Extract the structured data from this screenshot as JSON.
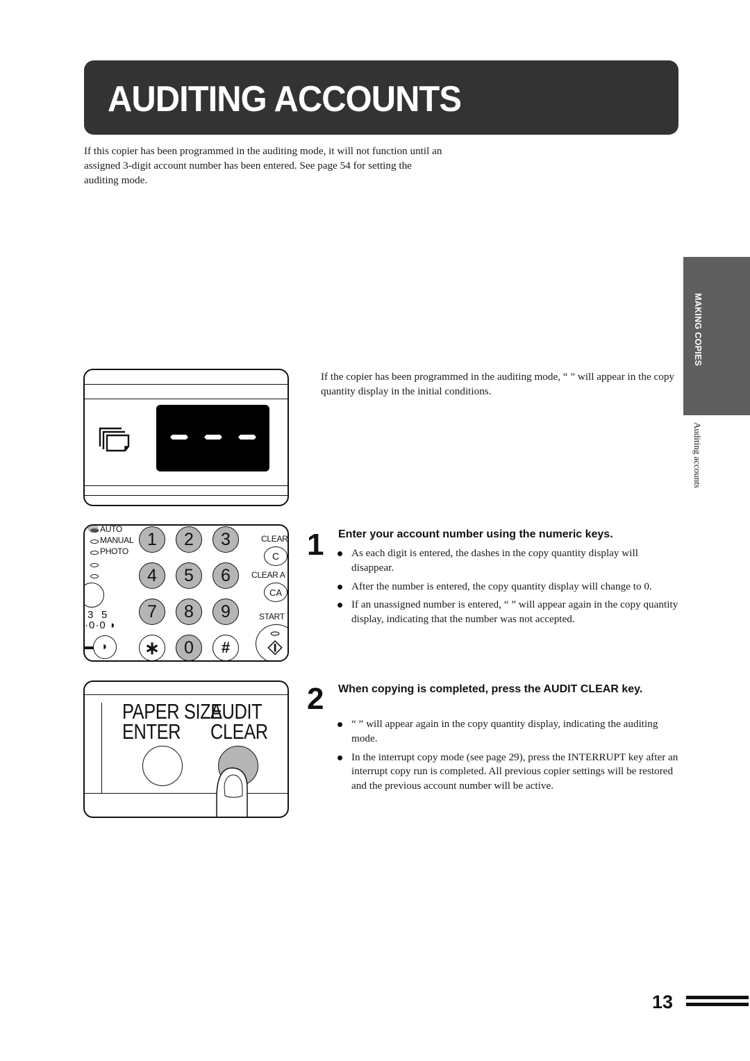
{
  "header": {
    "title": "AUDITING ACCOUNTS"
  },
  "intro": "If this copier  has been programmed in the auditing mode, it will not function until an assigned 3-digit account number has been entered. See page 54 for setting the auditing mode.",
  "side_tab": {
    "section": "MAKING COPIES",
    "subsection": "Auditing accounts"
  },
  "display_panel": {
    "icon": "copies-stack-icon",
    "readout": "- - -"
  },
  "display_description": "If the copier has been programmed in the auditing mode, “        ” will appear in the copy quantity display in the initial conditions.",
  "keypad_panel": {
    "exposure_modes": [
      "AUTO",
      "MANUAL",
      "PHOTO"
    ],
    "density_labels": [
      "3",
      "5"
    ],
    "keys": [
      "1",
      "2",
      "3",
      "4",
      "5",
      "6",
      "7",
      "8",
      "9",
      "∗",
      "0",
      "#"
    ],
    "clear_label": "CLEAR",
    "clear_key": "C",
    "clear_all_label": "CLEAR A",
    "clear_all_key": "CA",
    "start_label": "START"
  },
  "audit_panel": {
    "paper_size_label_line1": "PAPER SIZE",
    "paper_size_label_line2": "ENTER",
    "audit_label_line1": "AUDIT",
    "audit_label_line2": "CLEAR"
  },
  "steps": [
    {
      "number": "1",
      "heading": "Enter your account number using the numeric keys.",
      "bullets": [
        "As each digit is entered, the dashes in the copy quantity display will disappear.",
        "After the number is entered, the copy quantity display will change to 0.",
        "If an unassigned number is entered, “        ” will appear again in the copy quantity display, indicating that the number was not accepted."
      ]
    },
    {
      "number": "2",
      "heading": "When copying is completed, press the AUDIT CLEAR key.",
      "bullets": [
        "“        ” will appear again in the copy quantity display, indicating the auditing mode.",
        "In the interrupt copy mode (see page 29), press the INTERRUPT key after an interrupt copy run is completed. All previous copier settings will be restored and the previous account number will be active."
      ]
    }
  ],
  "footer": {
    "page_number": "13"
  }
}
